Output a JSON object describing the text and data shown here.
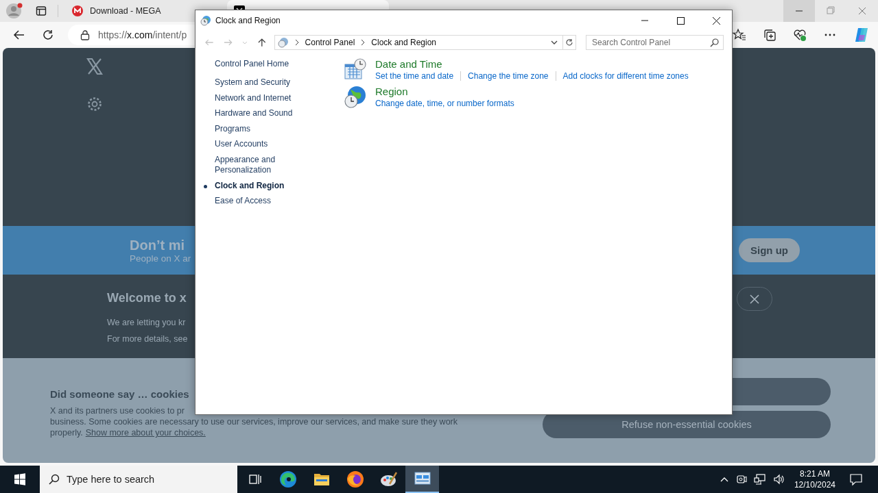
{
  "browser": {
    "tabs": [
      {
        "title": "Download - MEGA",
        "kind": "mega",
        "selected": false
      },
      {
        "kind": "x",
        "selected": true
      }
    ],
    "url": {
      "scheme": "https://",
      "host": "x.com",
      "path": "/intent/p"
    }
  },
  "page": {
    "banner": {
      "title": "Don’t mi",
      "subtitle": "People on X ar",
      "button": "Sign up"
    },
    "welcome": {
      "title": "Welcome to x",
      "lines": [
        "We are letting you kr",
        "For more details, see"
      ]
    },
    "cookies": {
      "title": "Did someone say … cookies",
      "lines": [
        "X and its partners use cookies to pr",
        "business. Some cookies are necessary to use our services, improve our services, and make sure they work"
      ],
      "last_line": "properly.",
      "link": "Show more about your choices.",
      "buttons": [
        {
          "kind": "accept"
        },
        {
          "kind": "refuse",
          "label": "Refuse non-essential cookies"
        }
      ]
    }
  },
  "window": {
    "title": "Clock and Region",
    "breadcrumb": [
      "Control Panel",
      "Clock and Region"
    ],
    "search": {
      "placeholder": "Search Control Panel"
    },
    "sidebar": {
      "home": "Control Panel Home",
      "items": [
        {
          "label": "System and Security",
          "selected": false
        },
        {
          "label": "Network and Internet",
          "selected": false
        },
        {
          "label": "Hardware and Sound",
          "selected": false
        },
        {
          "label": "Programs",
          "selected": false
        },
        {
          "label": "User Accounts",
          "selected": false
        },
        {
          "label": "Appearance and Personalization",
          "selected": false
        },
        {
          "label": "Clock and Region",
          "selected": true
        },
        {
          "label": "Ease of Access",
          "selected": false
        }
      ]
    },
    "categories": [
      {
        "kind": "calendar-clock",
        "title": "Date and Time",
        "links": [
          "Set the time and date",
          "Change the time zone",
          "Add clocks for different time zones"
        ]
      },
      {
        "kind": "globe-clock",
        "title": "Region",
        "links": [
          "Change date, time, or number formats"
        ]
      }
    ]
  },
  "taskbar": {
    "search": {
      "placeholder": "Type here to search"
    },
    "apps": [
      {
        "kind": "task-view",
        "selected": false
      },
      {
        "kind": "edge",
        "selected": false
      },
      {
        "kind": "explorer",
        "selected": false
      },
      {
        "kind": "firefox",
        "selected": false
      },
      {
        "kind": "paint",
        "selected": false
      },
      {
        "kind": "control-panel",
        "selected": true
      }
    ],
    "time": "8:21 AM",
    "date": "12/10/2024"
  }
}
